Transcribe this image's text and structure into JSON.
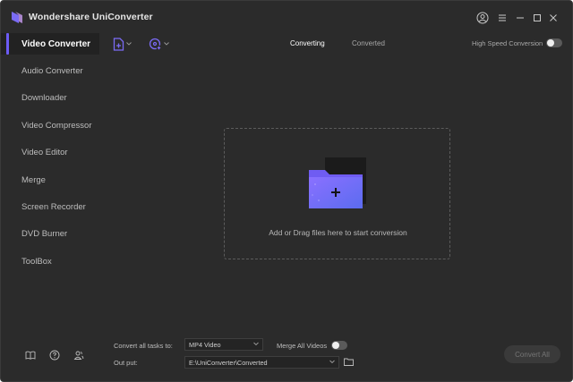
{
  "app": {
    "title": "Wondershare UniConverter"
  },
  "colors": {
    "background": "#2b2b2b",
    "sidebar_active": "#222222",
    "accent": "#6c5cf6",
    "folder": "#7b6bf5"
  },
  "window_controls": [
    {
      "name": "account-icon"
    },
    {
      "name": "menu-icon"
    },
    {
      "name": "minimize-icon"
    },
    {
      "name": "maximize-icon"
    },
    {
      "name": "close-icon"
    }
  ],
  "sidebar": {
    "items": [
      {
        "label": "Video Converter",
        "active": true
      },
      {
        "label": "Audio Converter",
        "active": false
      },
      {
        "label": "Downloader",
        "active": false
      },
      {
        "label": "Video Compressor",
        "active": false
      },
      {
        "label": "Video Editor",
        "active": false
      },
      {
        "label": "Merge",
        "active": false
      },
      {
        "label": "Screen Recorder",
        "active": false
      },
      {
        "label": "DVD Burner",
        "active": false
      },
      {
        "label": "ToolBox",
        "active": false
      }
    ],
    "bottom_icons": [
      "book-icon",
      "help-icon",
      "user-group-icon"
    ]
  },
  "toolbar": {
    "add_files_icon": "add-file-icon",
    "add_dvd_icon": "add-dvd-icon",
    "tabs": [
      {
        "label": "Converting",
        "active": true
      },
      {
        "label": "Converted",
        "active": false
      }
    ],
    "high_speed_label": "High Speed Conversion",
    "high_speed_on": false
  },
  "dropzone": {
    "text": "Add or Drag files here to start conversion"
  },
  "bottom": {
    "convert_all_label": "Convert all tasks to:",
    "format_value": "MP4 Video",
    "merge_label": "Merge All Videos",
    "merge_on": false,
    "output_label": "Out put:",
    "output_path": "E:\\UniConverter\\Converted",
    "convert_all_button": "Convert All"
  }
}
